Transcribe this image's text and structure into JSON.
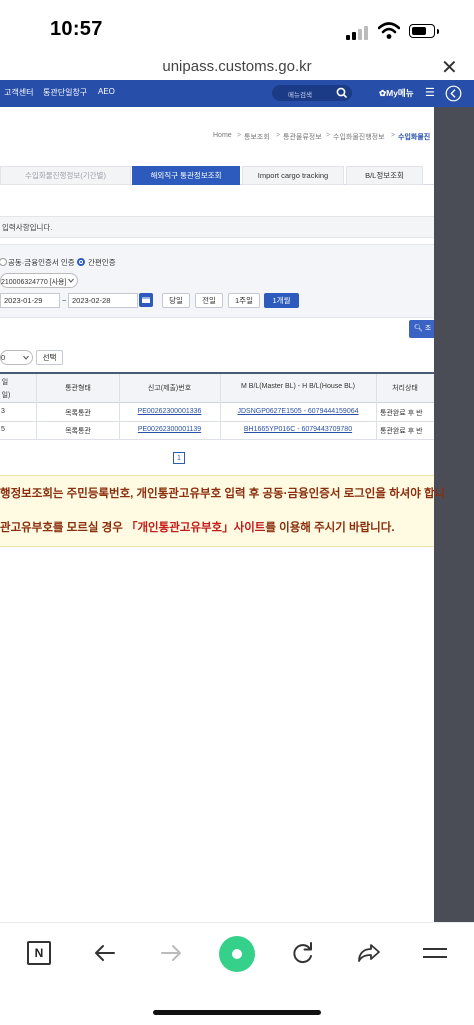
{
  "status_bar": {
    "time": "10:57"
  },
  "browser": {
    "url": "unipass.customs.go.kr"
  },
  "site_nav": {
    "links": [
      "고객센터",
      "통관단일창구",
      "AEO"
    ],
    "search_placeholder": "메뉴검색",
    "my_menu": "My메뉴"
  },
  "breadcrumb": [
    "Home",
    "통보조회",
    "통관물류정보",
    "수입화물진행정보",
    "수입화물진"
  ],
  "tabs": [
    "수입화물진행정보(기간별)",
    "해외직구 통관정보조회",
    "Import cargo tracking",
    "B/L정보조회"
  ],
  "notice": "입력사항입니다.",
  "auth": {
    "option1": "공동·금융인증서 인증",
    "option2": "간편인증",
    "selected": "간편인증",
    "account_select": "210006324770 [사용]"
  },
  "date_range": {
    "start": "2023-01-29",
    "separator": "~",
    "end": "2023-02-28",
    "quick_buttons": [
      "당일",
      "전일",
      "1주일",
      "1개월"
    ],
    "active_quick": "1개월"
  },
  "search_button": "조",
  "list_controls": {
    "page_size": "0",
    "select_button": "선택"
  },
  "table": {
    "headers": {
      "col1_line1": "일",
      "col1_line2": "일)",
      "col2": "통관형태",
      "col3": "신고(제출)번호",
      "col4": "M B/L(Master BL) - H B/L(House BL)",
      "col5": "처리상태"
    },
    "rows": [
      {
        "date": "3",
        "type": "목록통관",
        "decl_no": "PE00262300001336",
        "bl": "JDSNGP0627E1505 - 6079444159064",
        "status": "통관완료 후 반"
      },
      {
        "date": "5",
        "type": "목록통관",
        "decl_no": "PE00262300001139",
        "bl": "BH1665YP016C - 6079443709780",
        "status": "통관완료 후 반"
      }
    ],
    "page": "1"
  },
  "warning": {
    "line1": "행정보조회는 주민등록번호, 개인통관고유부호 입력 후 공동·금융인증서 로그인을 하셔야 합니",
    "line2_before": "관고유부호를 모르실 경우 ",
    "line2_link": "「개인통관고유부호」사이트",
    "line2_after": "를 이용해 주시기 바랍니다."
  },
  "toolbar": {
    "n_label": "N"
  },
  "colors": {
    "nav": "#274ea8",
    "accent": "#2d5bbd",
    "warning_text": "#8a2e0e",
    "warning_highlight": "#c41a1a",
    "green": "#35d08a"
  }
}
